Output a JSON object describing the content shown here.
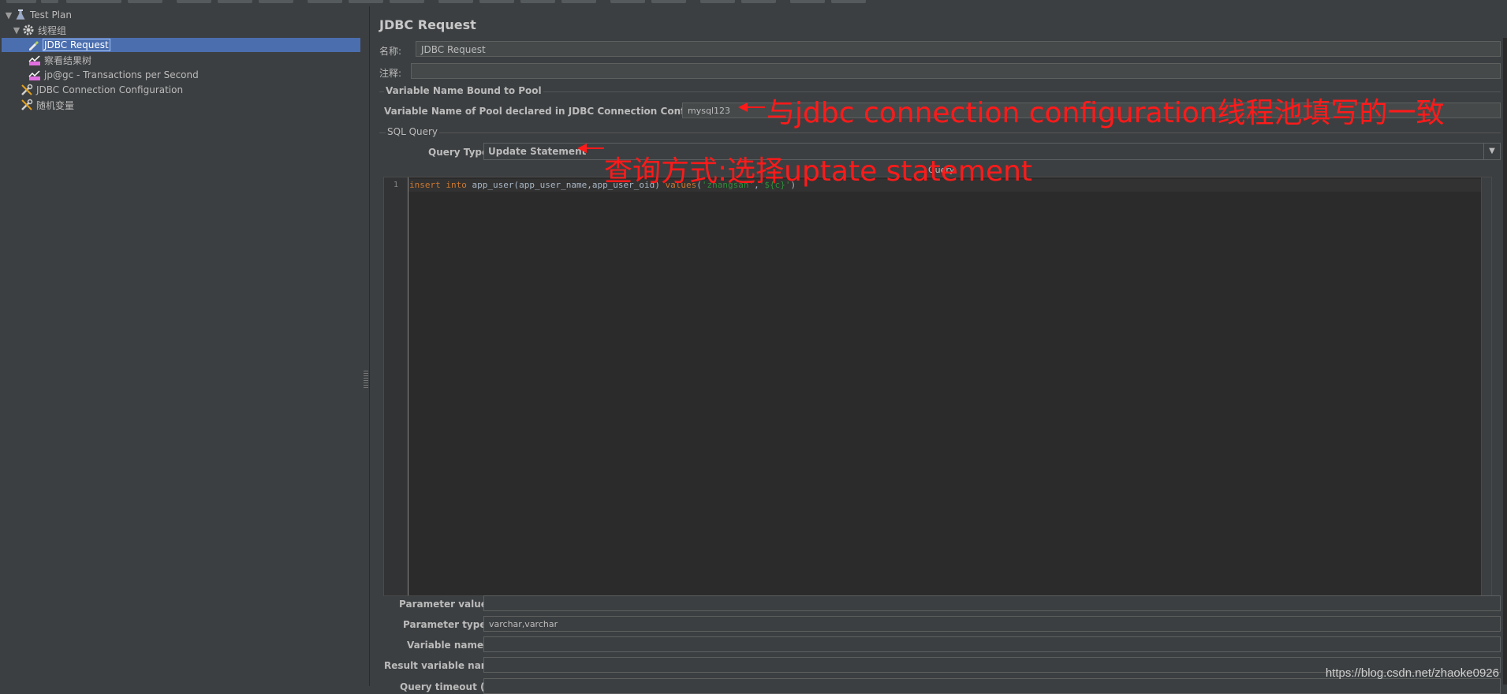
{
  "tree": {
    "items": [
      {
        "label": "Test Plan"
      },
      {
        "label": "线程组"
      },
      {
        "label": "JDBC Request"
      },
      {
        "label": "察看结果树"
      },
      {
        "label": "jp@gc - Transactions per Second"
      },
      {
        "label": "JDBC Connection Configuration"
      },
      {
        "label": "随机变量"
      }
    ],
    "selected": "JDBC Request"
  },
  "panel": {
    "title": "JDBC Request",
    "name_label": "名称:",
    "name_value": "JDBC Request",
    "comment_label": "注释:",
    "comment_value": "",
    "pool_group_title": "Variable Name Bound to Pool",
    "pool_label": "Variable Name of Pool declared in JDBC Connection Configuration:",
    "pool_value": "mysql123",
    "sql_group_title": "SQL Query",
    "query_type_label": "Query Type:",
    "query_type_value": "Update Statement",
    "query_label": "Query:",
    "query_line_number": "1",
    "query_code": {
      "k1": "insert",
      "k2": "into",
      "mid": "app_user(app_user_name,app_user_oid)",
      "k3": "values",
      "open": "(",
      "s1": "'zhangsan'",
      "comma": ",",
      "s2": "'${c}'",
      "close": ")"
    },
    "param_values_label": "Parameter values:",
    "param_values_value": "",
    "param_types_label": "Parameter types:",
    "param_types_value": "varchar,varchar",
    "variable_names_label": "Variable names:",
    "variable_names_value": "",
    "result_variable_label": "Result variable name:",
    "result_variable_value": "",
    "query_timeout_label": "Query timeout (s):"
  },
  "annotations": {
    "pool_note": "与jdbc connection configuration线程池填写的一致",
    "query_type_note": "查询方式:选择uptate statement"
  },
  "watermark": "https://blog.csdn.net/zhaoke0926",
  "colors": {
    "background": "#3c3f41",
    "selection": "#4b6eaf",
    "annotation": "#ff1a1a",
    "editor_bg": "#2b2b2b"
  }
}
